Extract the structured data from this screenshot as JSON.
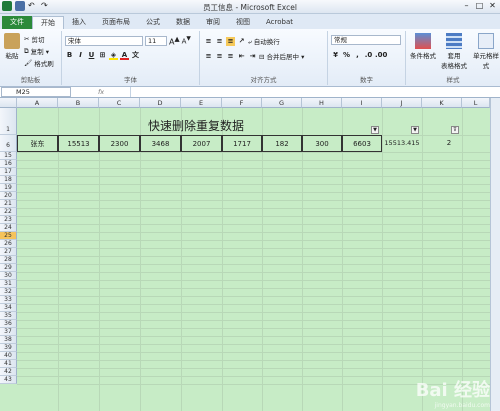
{
  "window": {
    "title": "员工信息 - Microsoft Excel",
    "controls": [
      "–",
      "□",
      "✕"
    ]
  },
  "tabs": [
    "文件",
    "开始",
    "插入",
    "页面布局",
    "公式",
    "数据",
    "审阅",
    "视图",
    "Acrobat"
  ],
  "ribbon": {
    "clipboard": {
      "paste": "粘贴",
      "cut": "剪切",
      "copy": "复制 ▾",
      "format_painter": "格式刷",
      "label": "剪贴板"
    },
    "font": {
      "name": "宋体",
      "size": "11",
      "label": "字体",
      "bold": "B",
      "italic": "I",
      "underline": "U"
    },
    "alignment": {
      "wrap": "自动换行",
      "merge": "合并后居中 ▾",
      "label": "对齐方式"
    },
    "number": {
      "format": "常规",
      "percent": "%",
      "comma": ",",
      "label": "数字"
    },
    "styles": {
      "conditional": "条件格式",
      "table": "套用\n表格格式",
      "cell": "单元格样式",
      "label": "样式"
    }
  },
  "formula_bar": {
    "name_box": "M25",
    "fx": "fx",
    "content": ""
  },
  "columns": [
    "A",
    "B",
    "C",
    "D",
    "E",
    "F",
    "G",
    "H",
    "I",
    "J",
    "K",
    "L"
  ],
  "rows": [
    "1",
    "6",
    "15",
    "16",
    "17",
    "18",
    "19",
    "20",
    "21",
    "22",
    "23",
    "24",
    "25",
    "26",
    "27",
    "28",
    "29",
    "30",
    "31",
    "32",
    "33",
    "34",
    "35",
    "36",
    "37",
    "38",
    "39",
    "40",
    "41",
    "42",
    "43"
  ],
  "selected_row": "25",
  "sheet": {
    "heading": "快速删除重复数据",
    "row6": [
      "张东",
      "15513",
      "2300",
      "3468",
      "2007",
      "1717",
      "182",
      "300",
      "6603",
      "15513.415",
      "2"
    ]
  },
  "watermark": {
    "text": "Bai 经验",
    "sub": "jingyan.baidu.com"
  }
}
